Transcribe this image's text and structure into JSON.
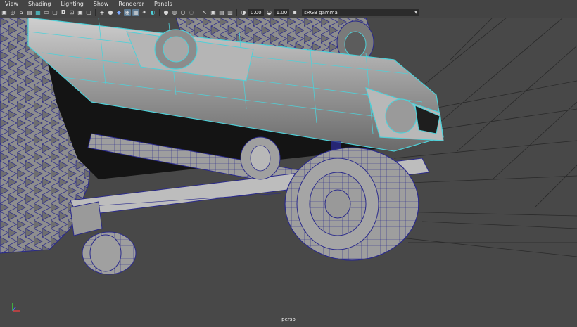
{
  "menu": [
    "View",
    "Shading",
    "Lighting",
    "Show",
    "Renderer",
    "Panels"
  ],
  "toolbar": {
    "exposure_value": "0.00",
    "gamma_value": "1.00",
    "color_space": "sRGB gamma"
  },
  "viewport": {
    "camera_label": "persp",
    "background_color": "#484848",
    "wire_color": "#4fd0d8",
    "mesh_fill_color": "#a8a8a8"
  }
}
